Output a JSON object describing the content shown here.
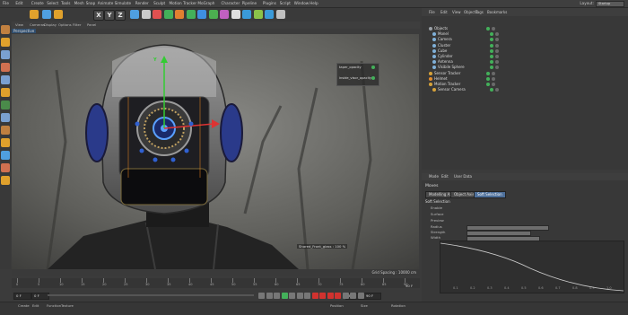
{
  "menubar": {
    "items": [
      "File",
      "Edit",
      "Create",
      "Select",
      "Tools",
      "Mesh",
      "Snap",
      "Animate",
      "Simulate",
      "Render",
      "Sculpt",
      "Motion Tracker",
      "MoGraph",
      "Character",
      "Pipeline",
      "Plugins",
      "Script",
      "Window",
      "Help"
    ],
    "layout_label": "Layout:",
    "layout_value": "Startup"
  },
  "toolbar": {
    "x_label": "X",
    "y_label": "Y",
    "z_label": "Z",
    "colors": [
      "#e0a12c",
      "#4f9fe0",
      "#e0a12c",
      "#4f9fe0",
      "#c9c9c9",
      "#e05050",
      "#43b05a",
      "#e08030",
      "#43b05a",
      "#3f8fe0",
      "#4caf50",
      "#c060c0",
      "#e0e0e0",
      "#3a9ad9",
      "#8bc34a",
      "#3a9ad9",
      "#c0c0c0"
    ]
  },
  "viewport": {
    "menu_items": [
      "View",
      "Cameras",
      "Display",
      "Options",
      "Filter",
      "Panel"
    ],
    "label": "Perspective",
    "overlay_labels": [
      "taper_opacity",
      "inside_visor_opacity"
    ],
    "axis_label": "Y",
    "status_text": "Shared_Front_glass : 100 %",
    "grid_spacing": "Grid Spacing : 10000 cm"
  },
  "timeline": {
    "ticks": [
      "0",
      "5",
      "10",
      "15",
      "20",
      "25",
      "30",
      "35",
      "40",
      "45",
      "50",
      "55",
      "60",
      "65",
      "70",
      "75",
      "80",
      "85",
      "90"
    ],
    "frame_end": "90 F",
    "current_frame": "0 F",
    "start_field": "0 F",
    "end_field": "90 F",
    "max_field": "90 F"
  },
  "material_bar": {
    "items": [
      "Create",
      "Edit",
      "Function",
      "Texture"
    ],
    "coord_headers": [
      "Position",
      "Size",
      "Rotation"
    ]
  },
  "objects": {
    "menu_items": [
      "File",
      "Edit",
      "View",
      "Objects",
      "Tags",
      "Bookmarks"
    ],
    "rows": [
      {
        "name": "Objects",
        "indent": 0,
        "color": "#9aa0a6"
      },
      {
        "name": "Monel",
        "indent": 1,
        "color": "#7fb0d8"
      },
      {
        "name": "Camera",
        "indent": 1,
        "color": "#7fb0d8"
      },
      {
        "name": "Cluster",
        "indent": 1,
        "color": "#7fb0d8"
      },
      {
        "name": "Cube",
        "indent": 1,
        "color": "#7fb0d8"
      },
      {
        "name": "Cylinder",
        "indent": 1,
        "color": "#7fb0d8"
      },
      {
        "name": "Antenna",
        "indent": 1,
        "color": "#7fb0d8"
      },
      {
        "name": "Visibile Sphere",
        "indent": 1,
        "color": "#7fb0d8"
      },
      {
        "name": "Sensor Tracker",
        "indent": 0,
        "color": "#d7a33a"
      },
      {
        "name": "Helmet",
        "indent": 0,
        "color": "#e38b2c"
      },
      {
        "name": "Motion Tracker",
        "indent": 0,
        "color": "#d7a33a"
      },
      {
        "name": "Sensor Camera",
        "indent": 1,
        "color": "#d7a33a"
      }
    ]
  },
  "attributes": {
    "tabs": [
      "Mode",
      "Edit",
      "User Data"
    ],
    "title": "Moves",
    "buttons": [
      "Modelling Axis",
      "Object Axis",
      "Soft Selection"
    ],
    "section": "Soft Selection",
    "props": [
      "Enable",
      "Surface",
      "Preview",
      "Radius",
      "Strength",
      "Width"
    ],
    "graph_labels": [
      "0.1",
      "0.2",
      "0.3",
      "0.4",
      "0.5",
      "0.6",
      "0.7",
      "0.8",
      "0.9",
      "1.0"
    ]
  }
}
